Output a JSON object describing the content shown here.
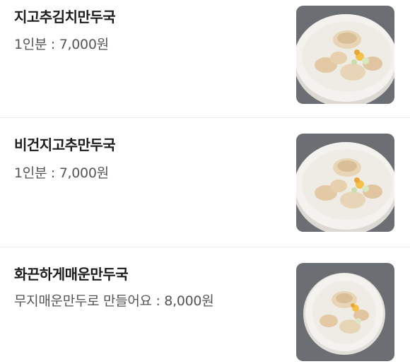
{
  "menu": {
    "items": [
      {
        "name": "지고추김치만두국",
        "description": "1인분 : 7,000원",
        "image": "dumpling-soup-photo"
      },
      {
        "name": "비건지고추만두국",
        "description": "1인분 : 7,000원",
        "image": "dumpling-soup-photo"
      },
      {
        "name": "화끈하게매운만두국",
        "description": "무지매운만두로 만들어요 : 8,000원",
        "image": "dumpling-soup-photo"
      }
    ]
  },
  "colors": {
    "background": "#ffffff",
    "title": "#1b1b1b",
    "description": "#555555",
    "divider": "#ececec",
    "bowl": "#f4f2ef",
    "broth": "#efece6",
    "dumpling": "#e8d5b7",
    "table": "#6b6f73"
  }
}
